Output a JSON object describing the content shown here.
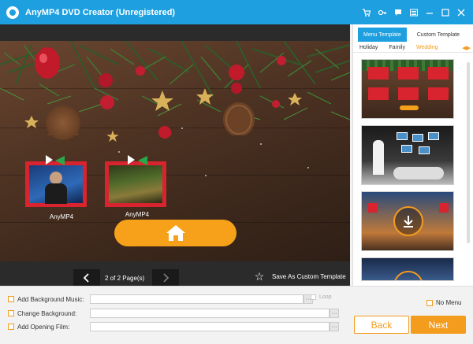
{
  "app": {
    "title": "AnyMP4 DVD Creator (Unregistered)"
  },
  "titlebar_icons": [
    "cart-icon",
    "key-icon",
    "chat-icon",
    "menu-icon",
    "minimize-icon",
    "maximize-icon",
    "close-icon"
  ],
  "preview": {
    "items": [
      {
        "label": "AnyMP4"
      },
      {
        "label": "AnyMP4"
      }
    ],
    "pager": {
      "text": "2 of 2 Page(s)"
    },
    "save_custom_label": "Save As Custom Template"
  },
  "panel": {
    "tabs": [
      {
        "label": "Menu Template",
        "active": true
      },
      {
        "label": "Custom Template",
        "active": false
      }
    ],
    "categories": [
      {
        "label": "Holiday",
        "active": false
      },
      {
        "label": "Family",
        "active": false
      },
      {
        "label": "Wedding",
        "active": true
      }
    ]
  },
  "options": {
    "bg_music_label": "Add Background Music:",
    "change_bg_label": "Change Background:",
    "opening_film_label": "Add Opening Film:",
    "loop_label": "Loop",
    "no_menu_label": "No Menu",
    "browse_label": "···"
  },
  "buttons": {
    "back": "Back",
    "next": "Next"
  },
  "colors": {
    "accent_blue": "#1d9fe0",
    "accent_orange": "#f39c1e",
    "frame_red": "#d8242e"
  }
}
